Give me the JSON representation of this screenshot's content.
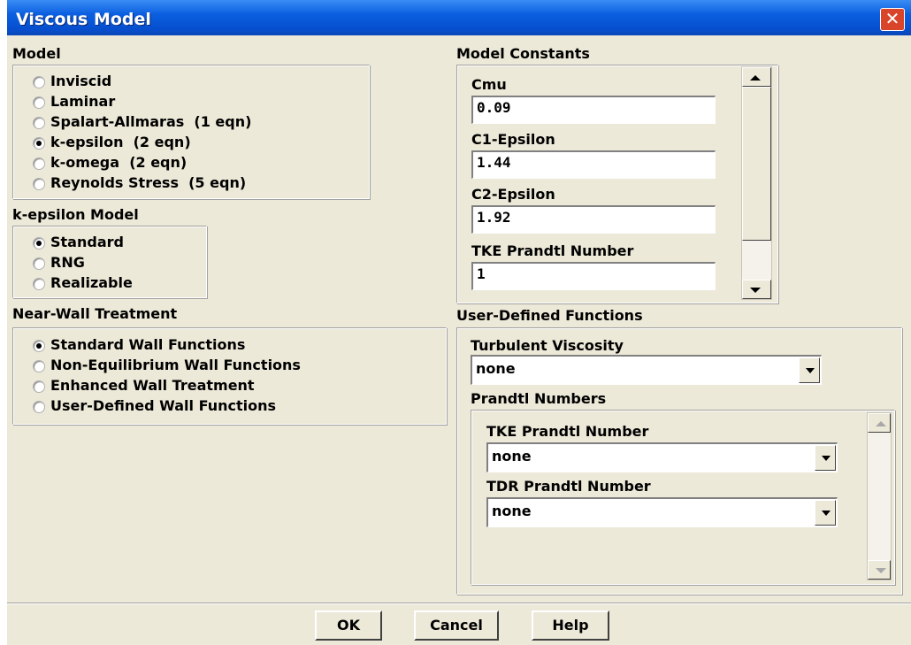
{
  "window": {
    "title": "Viscous Model"
  },
  "model": {
    "heading": "Model",
    "options": [
      "Inviscid",
      "Laminar",
      "Spalart-Allmaras  (1 eqn)",
      "k-epsilon  (2 eqn)",
      "k-omega  (2 eqn)",
      "Reynolds Stress  (5 eqn)"
    ],
    "selected": "k-epsilon  (2 eqn)"
  },
  "kepsilon": {
    "heading": "k-epsilon Model",
    "options": [
      "Standard",
      "RNG",
      "Realizable"
    ],
    "selected": "Standard"
  },
  "nearwall": {
    "heading": "Near-Wall Treatment",
    "options": [
      "Standard Wall Functions",
      "Non-Equilibrium Wall Functions",
      "Enhanced Wall Treatment",
      "User-Defined Wall Functions"
    ],
    "selected": "Standard Wall Functions"
  },
  "constants": {
    "heading": "Model Constants",
    "items": [
      {
        "label": "Cmu",
        "value": "0.09"
      },
      {
        "label": "C1-Epsilon",
        "value": "1.44"
      },
      {
        "label": "C2-Epsilon",
        "value": "1.92"
      },
      {
        "label": "TKE Prandtl Number",
        "value": "1"
      }
    ]
  },
  "udf": {
    "heading": "User-Defined Functions",
    "turbulent_viscosity": {
      "label": "Turbulent Viscosity",
      "value": "none"
    },
    "prandtl": {
      "heading": "Prandtl Numbers",
      "tke": {
        "label": "TKE Prandtl Number",
        "value": "none"
      },
      "tdr": {
        "label": "TDR Prandtl Number",
        "value": "none"
      }
    }
  },
  "buttons": {
    "ok": "OK",
    "cancel": "Cancel",
    "help": "Help"
  },
  "icons": {
    "close": "close-icon",
    "radio": "radio-icon",
    "dropdown": "chevron-down-icon",
    "scroll_up": "scroll-up-icon",
    "scroll_down": "scroll-down-icon"
  }
}
